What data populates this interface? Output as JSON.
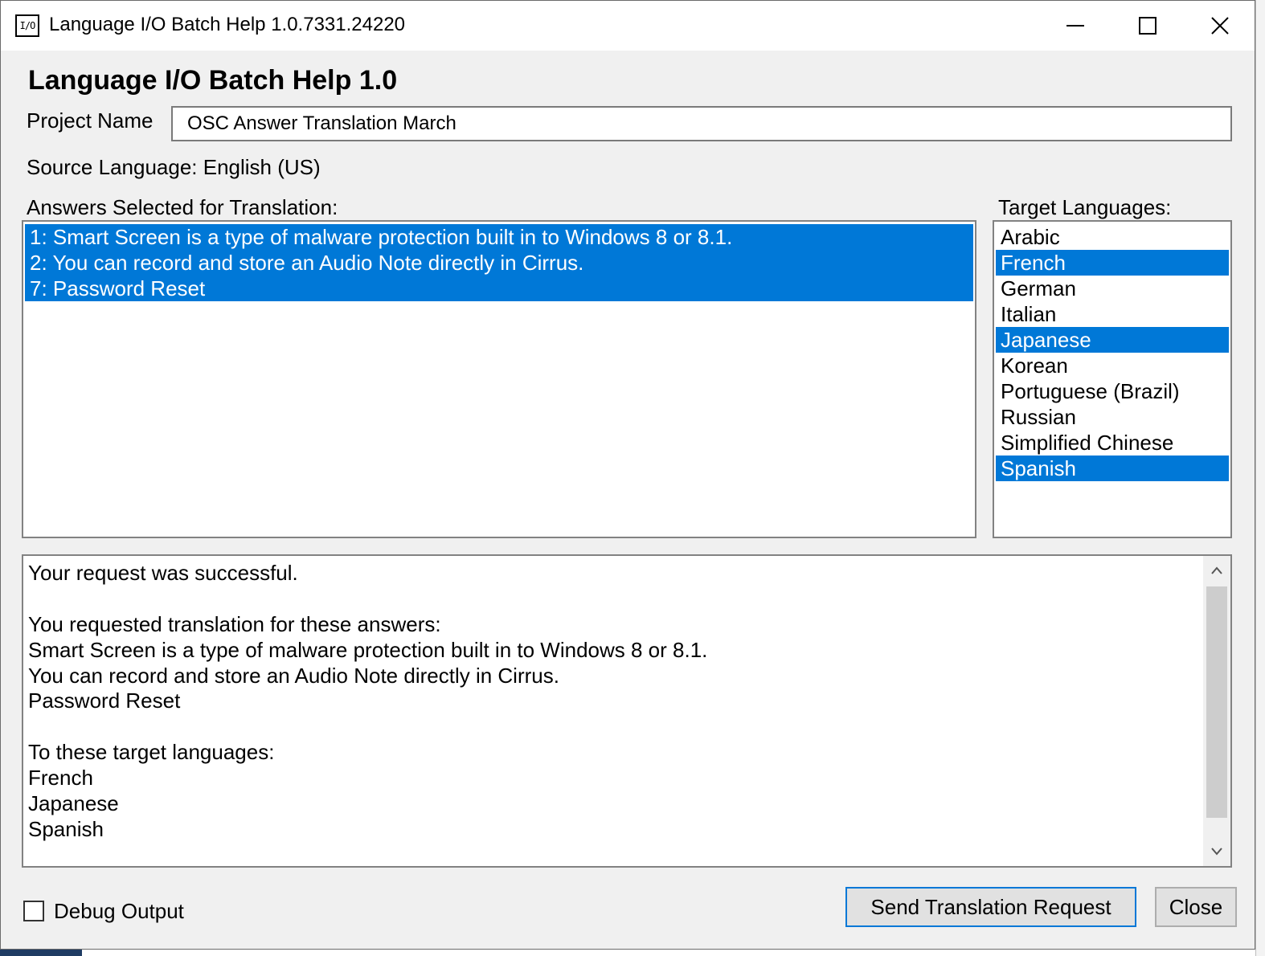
{
  "window": {
    "title": "Language I/O Batch Help 1.0.7331.24220",
    "icon_text": "I/O",
    "controls": [
      "minimize-icon",
      "maximize-icon",
      "close-icon"
    ]
  },
  "form": {
    "heading": "Language I/O Batch Help 1.0",
    "project_label": "Project Name",
    "project_value": "OSC Answer Translation March",
    "source_language": "Source Language: English (US)",
    "answers_label": "Answers Selected for Translation:",
    "targets_label": "Target Languages:"
  },
  "answers": [
    {
      "label": "1: Smart Screen is a type of malware protection built in to Windows 8 or 8.1.",
      "selected": true
    },
    {
      "label": "2: You can record and store an Audio Note directly in Cirrus.",
      "selected": true
    },
    {
      "label": "7: Password Reset",
      "selected": true
    }
  ],
  "target_languages": [
    {
      "label": "Arabic",
      "selected": false
    },
    {
      "label": "French",
      "selected": true
    },
    {
      "label": "German",
      "selected": false
    },
    {
      "label": "Italian",
      "selected": false
    },
    {
      "label": "Japanese",
      "selected": true
    },
    {
      "label": "Korean",
      "selected": false
    },
    {
      "label": "Portuguese (Brazil)",
      "selected": false
    },
    {
      "label": "Russian",
      "selected": false
    },
    {
      "label": "Simplified Chinese",
      "selected": false
    },
    {
      "label": "Spanish",
      "selected": true
    }
  ],
  "output": {
    "lines": [
      "Your request was successful.",
      "",
      "You requested translation for these answers:",
      "Smart Screen is a type of malware protection built in to Windows 8 or 8.1.",
      "You can record and store an Audio Note directly in Cirrus.",
      "Password Reset",
      "",
      "To these target languages:",
      "French",
      "Japanese",
      "Spanish"
    ]
  },
  "footer": {
    "debug_label": "Debug Output",
    "debug_checked": false,
    "send_label": "Send Translation Request",
    "close_label": "Close"
  },
  "colors": {
    "selection": "#0078d7",
    "window_bg": "#f0f0f0"
  }
}
